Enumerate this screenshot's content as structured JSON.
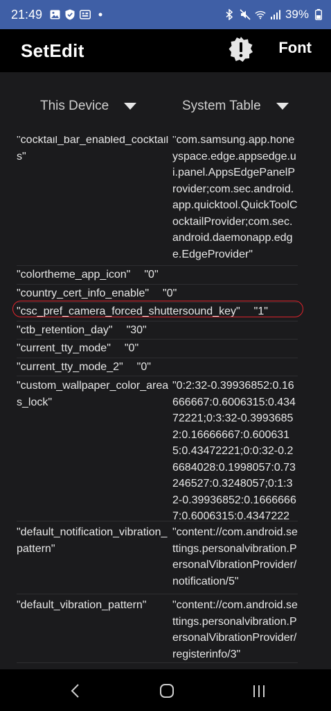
{
  "status_bar": {
    "time": "21:49",
    "battery": "39%",
    "left_icons": [
      "image-icon",
      "shield-icon",
      "cast-icon",
      "dot-icon"
    ],
    "right_icons": [
      "bluetooth-icon",
      "mute-icon",
      "wifi-icon",
      "signal-icon",
      "battery-icon"
    ]
  },
  "app_bar": {
    "title": "SetEdit",
    "font_label": "Font"
  },
  "selectors": {
    "device": "This Device",
    "table": "System Table"
  },
  "rows": [
    {
      "key": "\"cocktail_bar_enabled_cocktails\"",
      "value": "\"com.samsung.app.honeyspace.edge.appsedge.ui.panel.AppsEdgePanelProvider;com.sec.android.app.quicktool.QuickToolCocktailProvider;com.sec.android.daemonapp.edge.EdgeProvider\""
    },
    {
      "key": "\"colortheme_app_icon\"",
      "value": "\"0\""
    },
    {
      "key": "\"country_cert_info_enable\"",
      "value": "\"0\""
    },
    {
      "key": "\"csc_pref_camera_forced_shuttersound_key\"",
      "value": "\"1\""
    },
    {
      "key": "\"ctb_retention_day\"",
      "value": "\"30\""
    },
    {
      "key": "\"current_tty_mode\"",
      "value": "\"0\""
    },
    {
      "key": "\"current_tty_mode_2\"",
      "value": "\"0\""
    },
    {
      "key": "\"custom_wallpaper_color_areas_lock\"",
      "value": "\"0:2:32-0.39936852:0.16666667:0.6006315:0.43472221;0:3:32-0.39936852:0.16666667:0.6006315:0.43472221;0:0:32-0.26684028:0.1998057:0.73246527:0.3248057;0:1:32-0.39936852:0.16666667:0.6006315:0.43472221;\""
    },
    {
      "key": "\"default_notification_vibration_pattern\"",
      "value": "\"content://com.android.settings.personalvibration.PersonalVibrationProvider/notification/5\""
    },
    {
      "key": "\"default_vibration_pattern\"",
      "value": "\"content://com.android.settings.personalvibration.PersonalVibrationProvider/registerinfo/3\""
    }
  ],
  "nav_bar": {
    "icons": [
      "back-icon",
      "home-icon",
      "recents-icon"
    ]
  },
  "colors": {
    "status_bar": "#3f5fa6",
    "app_bar": "#000000",
    "background": "#1b1b1d",
    "highlight": "#e0242c"
  }
}
